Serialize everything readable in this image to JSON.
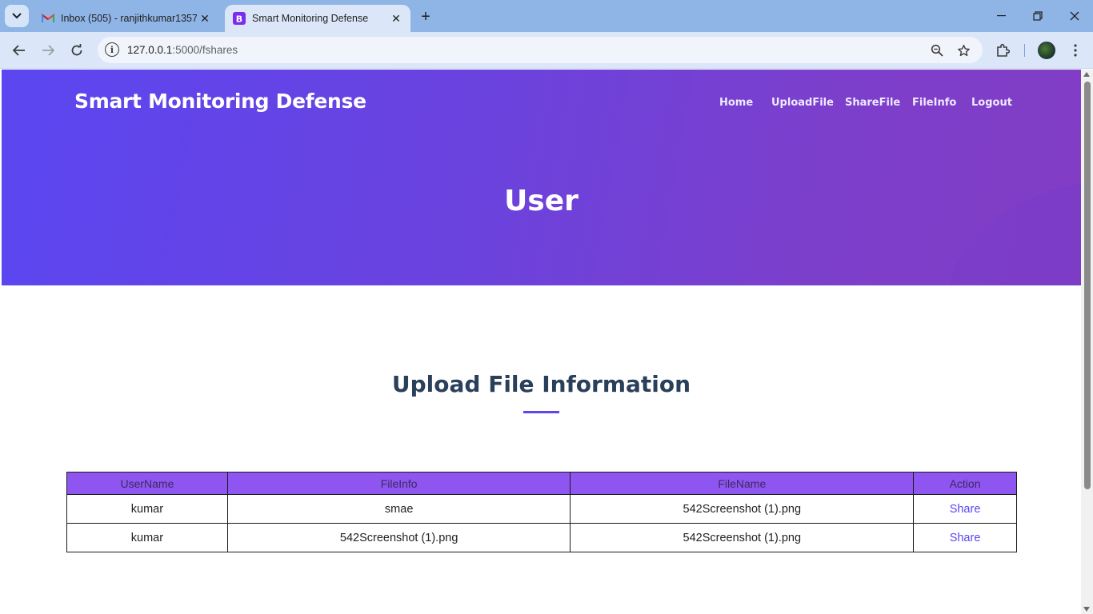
{
  "browser": {
    "tabs": [
      {
        "title": "Inbox (505) - ranjithkumar1357",
        "favicon": "gmail-icon",
        "active": false
      },
      {
        "title": "Smart Monitoring Defense",
        "favicon": "bootstrap-icon",
        "active": true
      }
    ],
    "url_host": "127.0.0.1",
    "url_path": ":5000/fshares"
  },
  "header": {
    "brand": "Smart Monitoring Defense",
    "nav": [
      "Home",
      "UploadFile",
      "ShareFile",
      "FileInfo",
      "Logout"
    ],
    "hero_title": "User"
  },
  "section": {
    "title": "Upload File Information",
    "accent_color": "#5b46f1"
  },
  "table": {
    "headers": [
      "UserName",
      "FileInfo",
      "FileName",
      "Action"
    ],
    "rows": [
      {
        "username": "kumar",
        "fileinfo": "smae",
        "filename": "542Screenshot (1).png",
        "action": "Share"
      },
      {
        "username": "kumar",
        "fileinfo": "542Screenshot (1).png",
        "filename": "542Screenshot (1).png",
        "action": "Share"
      }
    ]
  }
}
